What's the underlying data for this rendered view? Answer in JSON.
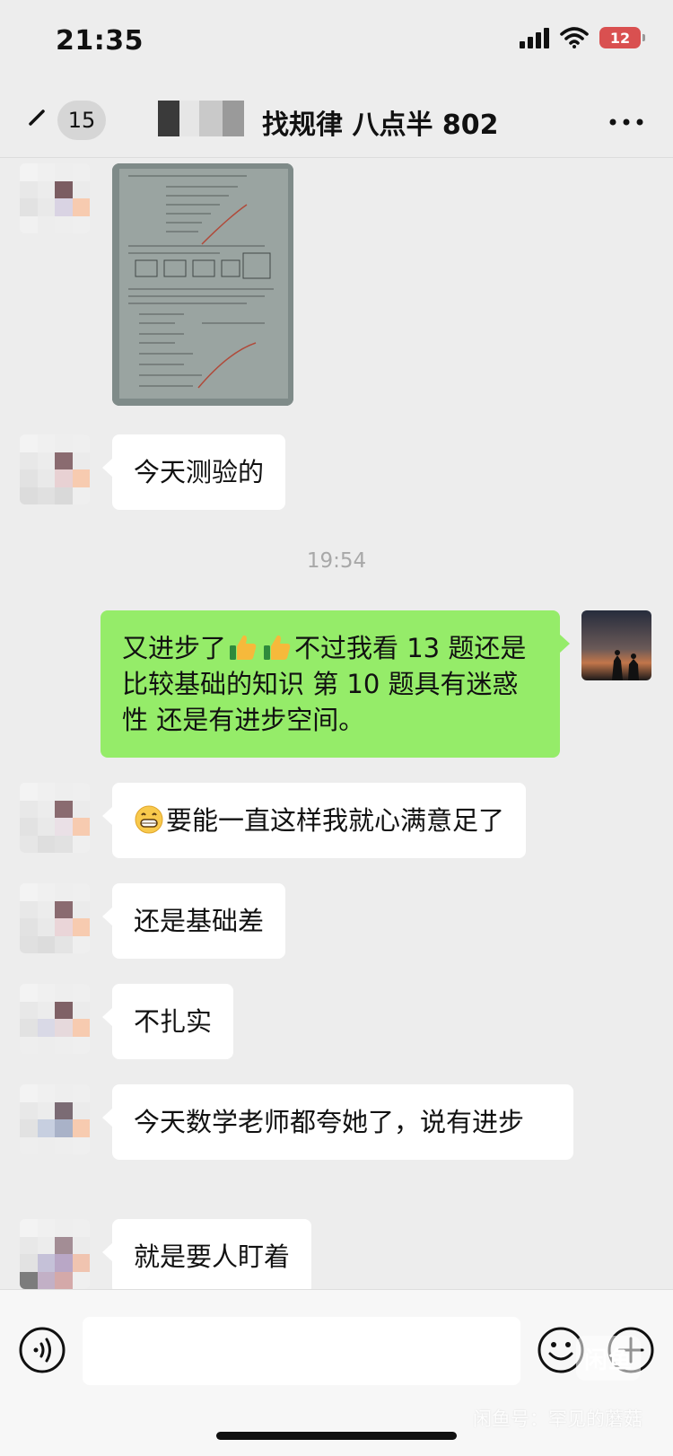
{
  "status_bar": {
    "time": "21:35",
    "battery": "12"
  },
  "nav": {
    "unread_count": "15",
    "title": "找规律 八点半 802"
  },
  "messages": [
    {
      "kind": "image",
      "side": "left"
    },
    {
      "kind": "text",
      "side": "left",
      "text": "今天测验的"
    },
    {
      "kind": "time",
      "text": "19:54"
    },
    {
      "kind": "text",
      "side": "right",
      "text_before": "又进步了",
      "text_after": "不过我看 13 题还是比较基础的知识 第 10 题具有迷惑性 还是有进步空间。",
      "emojis": [
        "thumbs-up",
        "thumbs-up"
      ]
    },
    {
      "kind": "text",
      "side": "left",
      "emoji": "grin",
      "text": "要能一直这样我就心满意足了"
    },
    {
      "kind": "text",
      "side": "left",
      "text": "还是基础差"
    },
    {
      "kind": "text",
      "side": "left",
      "text": "不扎实"
    },
    {
      "kind": "text",
      "side": "left",
      "text": "今天数学老师都夸她了，说有进步"
    },
    {
      "kind": "text",
      "side": "left",
      "text": "就是要人盯着"
    }
  ],
  "input": {
    "value": "",
    "placeholder": ""
  },
  "watermark": {
    "logo": "闲鱼",
    "text": "闲鱼号：罕见的蘑菇"
  },
  "colors": {
    "background": "#ededed",
    "self_bubble": "#95ec69",
    "other_bubble": "#ffffff",
    "battery": "#d95050"
  },
  "icons": [
    "back-icon",
    "wifi-icon",
    "signal-icon",
    "battery-icon",
    "more-icon",
    "voice-icon",
    "emoji-icon",
    "plus-icon",
    "thumbs-up-icon",
    "grin-icon"
  ]
}
